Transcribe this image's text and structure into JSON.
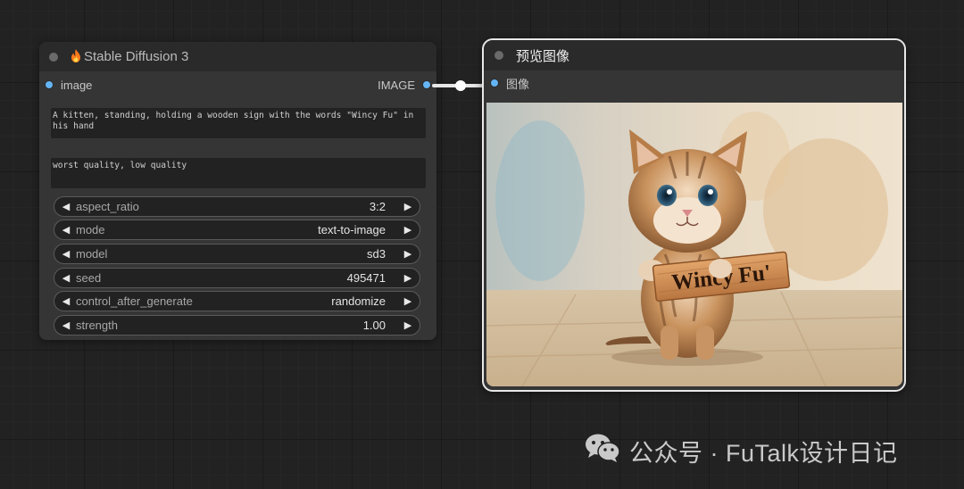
{
  "sd3_node": {
    "title": "Stable Diffusion 3",
    "title_icon": "fire-icon",
    "input_slot": "image",
    "output_slot": "IMAGE",
    "prompt_positive": "A kitten, standing, holding a wooden sign with the words \"Wincy Fu\" in his hand",
    "prompt_negative": "worst quality, low quality",
    "widgets": [
      {
        "label": "aspect_ratio",
        "value": "3:2"
      },
      {
        "label": "mode",
        "value": "text-to-image"
      },
      {
        "label": "model",
        "value": "sd3"
      },
      {
        "label": "seed",
        "value": "495471"
      },
      {
        "label": "control_after_generate",
        "value": "randomize"
      },
      {
        "label": "strength",
        "value": "1.00"
      }
    ]
  },
  "preview_node": {
    "title": "预览图像",
    "input_slot": "图像",
    "image_sign_text": "Wincy Fu'"
  },
  "watermark": {
    "text": "公众号 · FuTalk设计日记",
    "icon": "wechat-icon"
  },
  "colors": {
    "canvas": "#222222",
    "node_body": "#353535",
    "node_header": "#2a2a2a",
    "slot_image": "#64b5f6",
    "link": "#e6e6e6"
  }
}
